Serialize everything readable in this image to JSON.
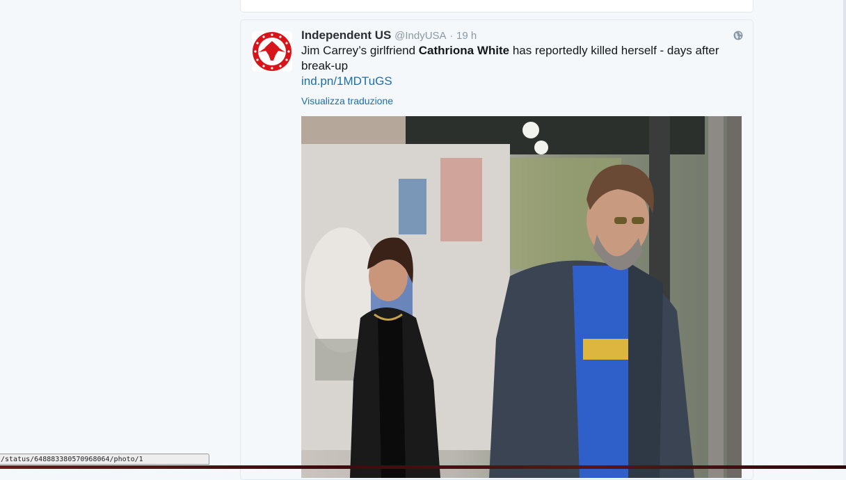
{
  "tweet": {
    "author_name": "Independent US",
    "author_handle": "@IndyUSA",
    "separator": "·",
    "time": "19 h",
    "text_before": "Jim Carrey’s girlfriend ",
    "text_bold": "Cathriona White",
    "text_after": " has reportedly killed herself - days after break-up",
    "link": "ind.pn/1MDTuGS",
    "translate_label": "Visualizza traduzione",
    "avatar_icon": "independent-eagle-logo",
    "globe_icon": "globe-icon",
    "photo_alt": "photo"
  },
  "statusbar": {
    "url": "/status/648883380570968064/photo/1"
  },
  "colors": {
    "link": "#1b6eaa",
    "meta": "#8899a6",
    "logo_red": "#d7141a"
  }
}
